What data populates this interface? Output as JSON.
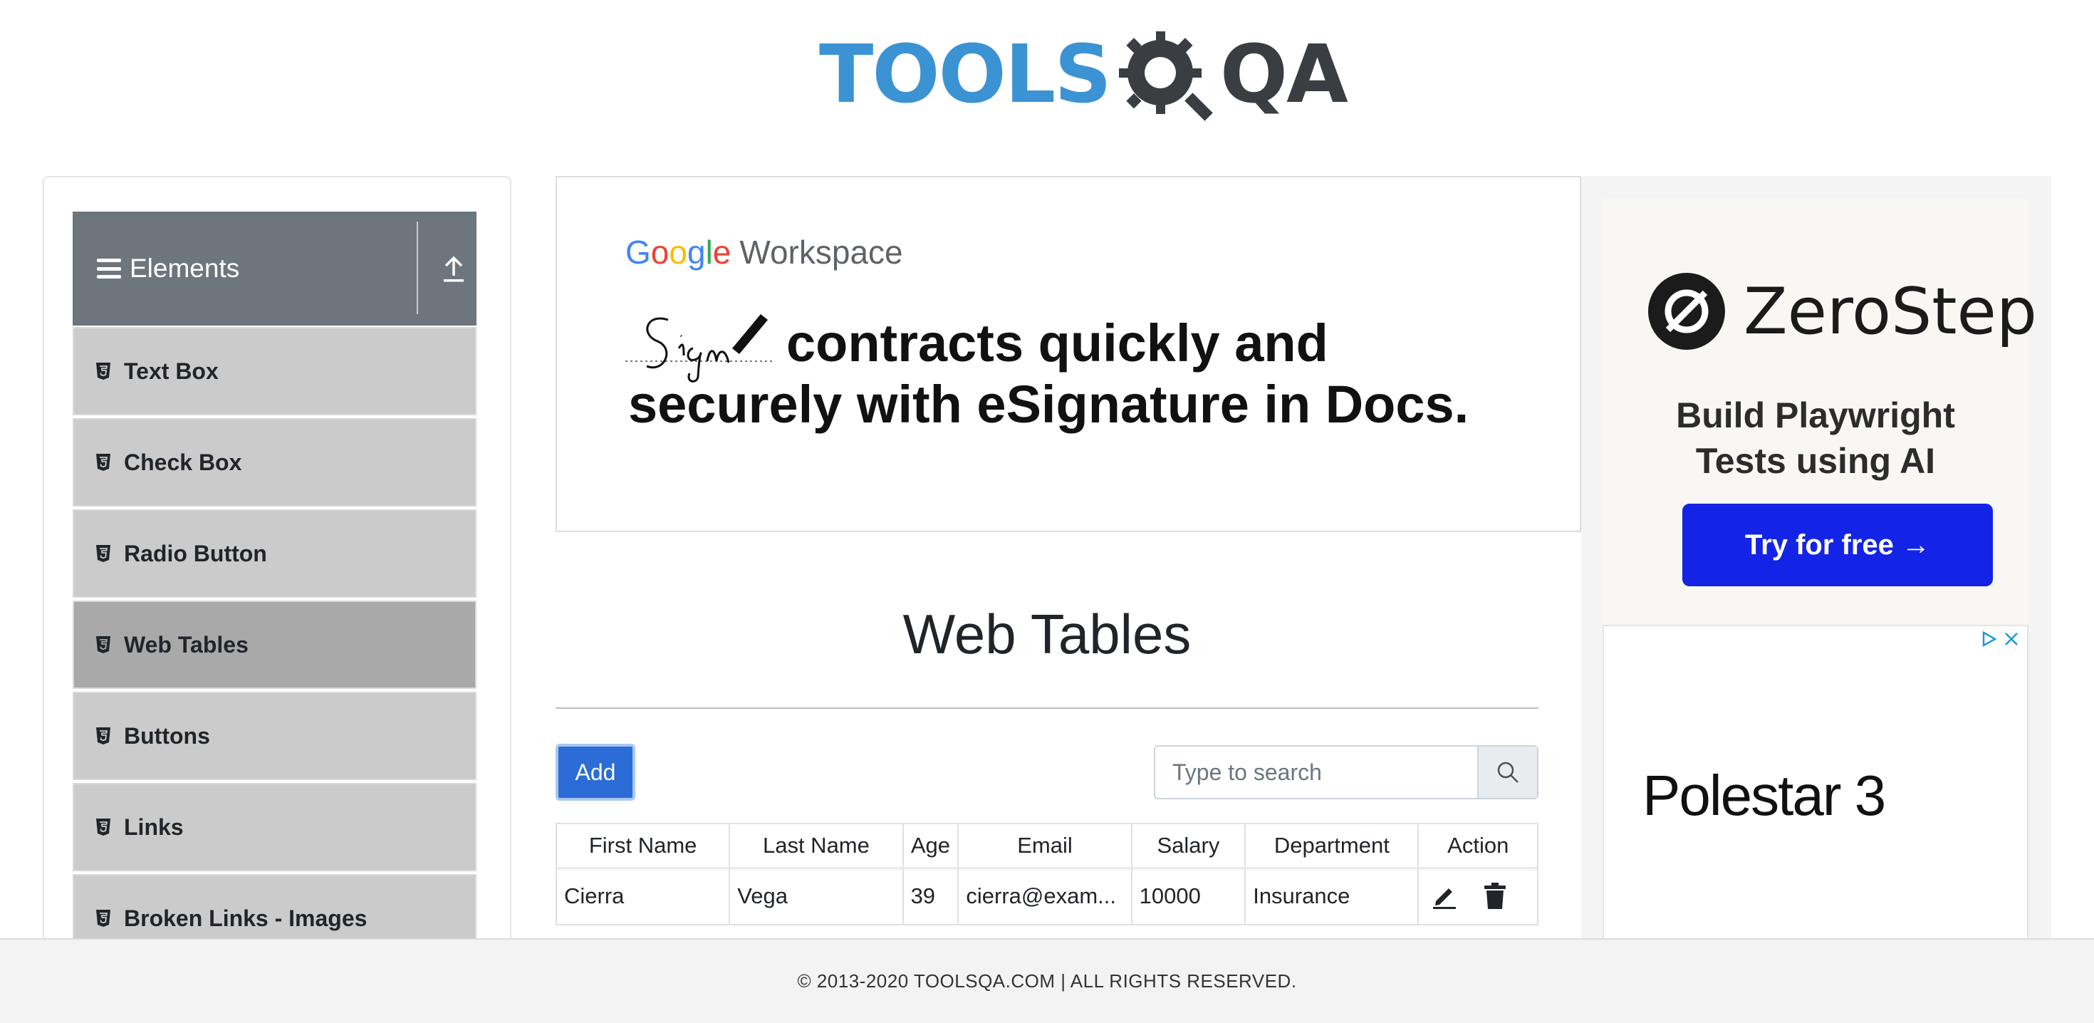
{
  "header": {
    "logo_part1": "TOOLS",
    "logo_part2": "QA"
  },
  "sidebar": {
    "group_title": "Elements",
    "items": [
      {
        "label": "Text Box"
      },
      {
        "label": "Check Box"
      },
      {
        "label": "Radio Button"
      },
      {
        "label": "Web Tables",
        "active": true
      },
      {
        "label": "Buttons"
      },
      {
        "label": "Links"
      },
      {
        "label": "Broken Links - Images"
      }
    ]
  },
  "ad_top": {
    "brand_google": "Google",
    "brand_workspace": "Workspace",
    "sign_word": "Sign",
    "headline_line1": "contracts quickly and",
    "headline_line2": "securely with eSignature in Docs."
  },
  "main": {
    "title": "Web Tables",
    "add_label": "Add",
    "search_placeholder": "Type to search",
    "table": {
      "headers": [
        "First Name",
        "Last Name",
        "Age",
        "Email",
        "Salary",
        "Department",
        "Action"
      ],
      "rows": [
        {
          "first": "Cierra",
          "last": "Vega",
          "age": "39",
          "email": "cierra@exam...",
          "salary": "10000",
          "department": "Insurance"
        }
      ]
    }
  },
  "ad_right": {
    "zerostep_name": "ZeroStep",
    "zerostep_tagline_line1": "Build Playwright",
    "zerostep_tagline_line2": "Tests using AI",
    "zerostep_cta": "Try for free →",
    "polestar_name": "Polestar 3"
  },
  "footer": {
    "copyright": "© 2013-2020 TOOLSQA.COM | ALL RIGHTS RESERVED."
  },
  "colors": {
    "brand_blue": "#3b93d4",
    "add_button": "#2b6cd6",
    "sidebar_header": "#6e767d",
    "zerostep_cta": "#1324e6"
  }
}
